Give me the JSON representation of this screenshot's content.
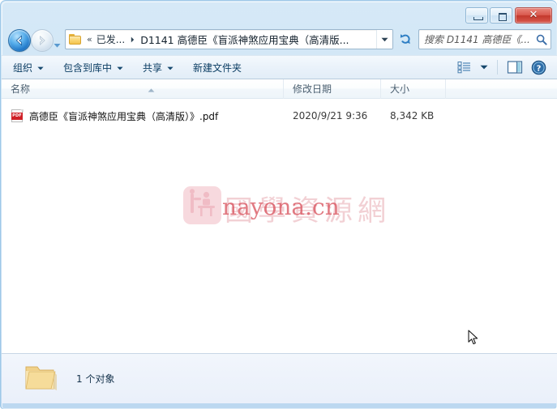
{
  "window": {
    "controls": {
      "minimize_label": "—",
      "maximize_label": "▫",
      "close_label": "✕"
    }
  },
  "address_bar": {
    "back_tooltip": "后退",
    "forward_tooltip": "前进",
    "history_tooltip": "最近浏览的位置",
    "folder_icon": "folder-icon",
    "overflow_chevrons": "«",
    "breadcrumb_segment": "已发...",
    "breadcrumb_separator": "▸",
    "current_path": "D1141 高德臣《盲派神煞应用宝典（高清版...",
    "dropdown_icon": "chevron-down-icon",
    "refresh_icon": "refresh-icon"
  },
  "search": {
    "placeholder": "搜索 D1141 高德臣《...",
    "value": "",
    "icon": "search-icon"
  },
  "command_bar": {
    "items": [
      {
        "label": "组织",
        "has_caret": true
      },
      {
        "label": "包含到库中",
        "has_caret": true
      },
      {
        "label": "共享",
        "has_caret": true
      },
      {
        "label": "新建文件夹",
        "has_caret": false
      }
    ],
    "caret_glyph": "▼",
    "view_icon": "view-list-icon",
    "view_caret": "▼",
    "preview_pane_icon": "preview-pane-icon",
    "help_icon": "help-icon"
  },
  "file_list": {
    "columns": [
      {
        "label": "名称",
        "key": "name"
      },
      {
        "label": "修改日期",
        "key": "date"
      },
      {
        "label": "大小",
        "key": "size"
      }
    ],
    "sort_column": "名称",
    "sort_direction": "asc",
    "rows": [
      {
        "icon": "pdf-file-icon",
        "icon_badge": "PDF",
        "name": "高德臣《盲派神煞应用宝典（高清版）》.pdf",
        "date": "2020/9/21 9:36",
        "size": "8,342 KB"
      }
    ]
  },
  "watermark": {
    "logo_name": "nayona-logo",
    "background_text": "國學資源網",
    "domain_text": "nayona.cn",
    "logo_color": "#f7d8dd",
    "background_text_color": "#f2d0d4",
    "domain_text_color": "#d95560"
  },
  "status_bar": {
    "folder_icon": "folder-icon",
    "item_count_text": "1 个对象"
  },
  "theme": {
    "frame_color": "#c7dff3",
    "close_button_color": "#c3392d",
    "accent_blue": "#1b72c4",
    "list_background": "#ffffff"
  }
}
